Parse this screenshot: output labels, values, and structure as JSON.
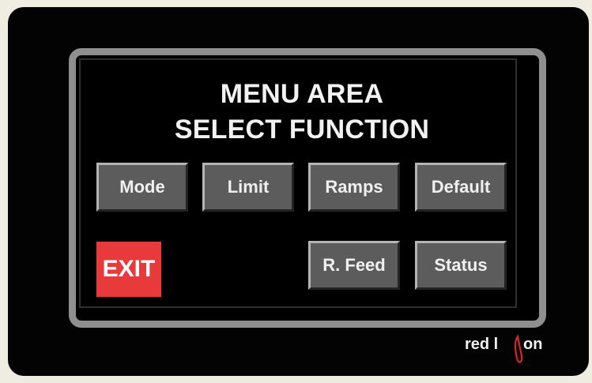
{
  "screen": {
    "title_line1": "MENU AREA",
    "title_line2": "SELECT FUNCTION"
  },
  "buttons": {
    "mode": "Mode",
    "limit": "Limit",
    "ramps": "Ramps",
    "default": "Default",
    "r_feed": "R. Feed",
    "status": "Status",
    "exit": "EXIT"
  },
  "brand": {
    "logo_text": "red lion",
    "logo_part1": "red l",
    "logo_part2": "on"
  },
  "colors": {
    "exit_button": "#e8393b",
    "button_face": "#5c5c5c",
    "bezel": "#030303",
    "frame": "#8f8f8f",
    "logo_accent": "#d3262b"
  }
}
